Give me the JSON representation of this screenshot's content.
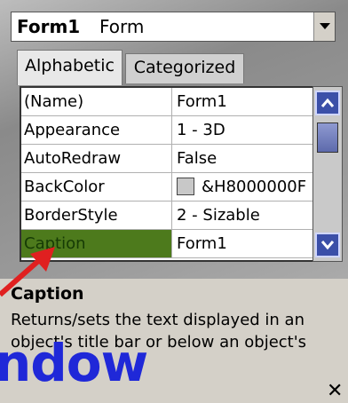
{
  "object_selector": {
    "name": "Form1",
    "type": "Form",
    "icon": "dropdown-arrow-icon"
  },
  "tabs": [
    {
      "label": "Alphabetic",
      "active": true
    },
    {
      "label": "Categorized",
      "active": false
    }
  ],
  "properties": [
    {
      "name": "(Name)",
      "value": "Form1"
    },
    {
      "name": "Appearance",
      "value": "1 - 3D"
    },
    {
      "name": "AutoRedraw",
      "value": "False"
    },
    {
      "name": "BackColor",
      "value": "&H8000000F",
      "swatch": "#c8c8c8"
    },
    {
      "name": "BorderStyle",
      "value": "2 - Sizable"
    },
    {
      "name": "Caption",
      "value": "Form1",
      "selected": true
    }
  ],
  "description": {
    "title": "Caption",
    "text": "Returns/sets the text displayed in an object's title bar or below an object's"
  },
  "overlay_text": "ndow",
  "close_glyph": "✕",
  "colors": {
    "selected_row": "#4d7a1c",
    "overlay_text": "#1f28d8",
    "arrow": "#e02020",
    "scroll_button": "#3b4fa8"
  }
}
